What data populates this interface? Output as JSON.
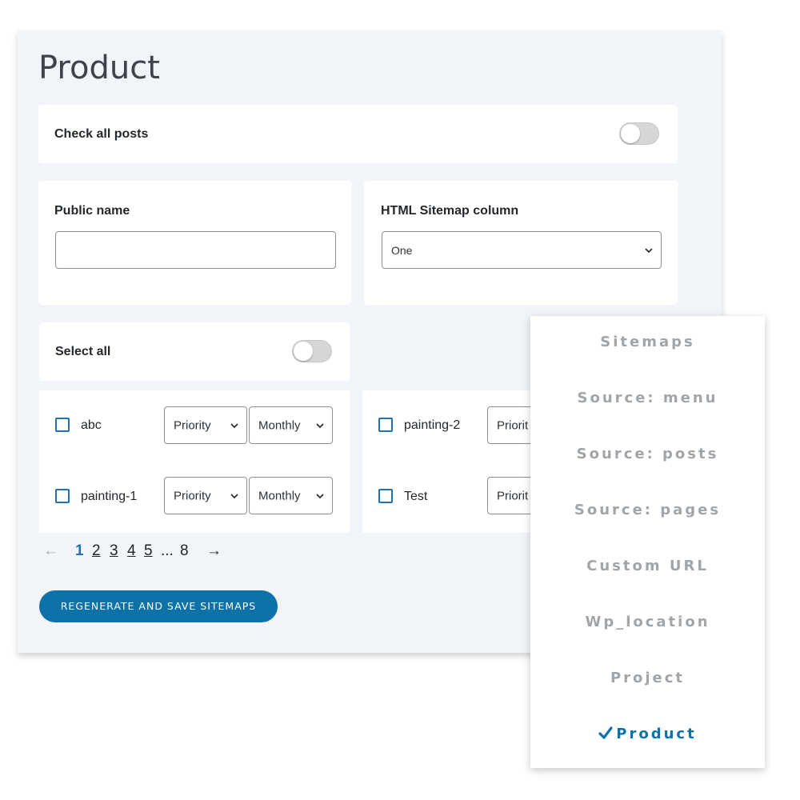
{
  "page": {
    "title": "Product"
  },
  "check_all": {
    "label": "Check all posts",
    "enabled": false
  },
  "public_name": {
    "label": "Public name",
    "value": "",
    "placeholder": ""
  },
  "column": {
    "label": "HTML Sitemap column",
    "value": "One"
  },
  "select_all": {
    "label": "Select all",
    "enabled": false
  },
  "posts": [
    {
      "name": "abc",
      "priority": "Priority",
      "frequency": "Monthly",
      "checked": false
    },
    {
      "name": "painting-2",
      "priority": "Priorit",
      "checked": false
    },
    {
      "name": "painting-1",
      "priority": "Priority",
      "frequency": "Monthly",
      "checked": false
    },
    {
      "name": "Test",
      "priority": "Priorit",
      "checked": false
    }
  ],
  "pagination": {
    "prev": "←",
    "current": "1",
    "pages": [
      "2",
      "3",
      "4",
      "5"
    ],
    "ellipsis": "...",
    "last": "8",
    "next": "→"
  },
  "actions": {
    "save_label": "REGENERATE AND SAVE SITEMAPS"
  },
  "menu": {
    "items": [
      {
        "label": "Sitemaps"
      },
      {
        "label": "Source: menu"
      },
      {
        "label": "Source: posts"
      },
      {
        "label": "Source: pages"
      },
      {
        "label": "Custom URL"
      },
      {
        "label": "Wp_location"
      },
      {
        "label": "Project"
      },
      {
        "label": "Product"
      }
    ],
    "active_index": 7,
    "active_icon": "checkmark-icon"
  },
  "colors": {
    "accent": "#0c72a8",
    "panel_bg": "#f1f4f9",
    "menu_text": "#a0a5aa",
    "checkbox_border": "#2271b1"
  }
}
